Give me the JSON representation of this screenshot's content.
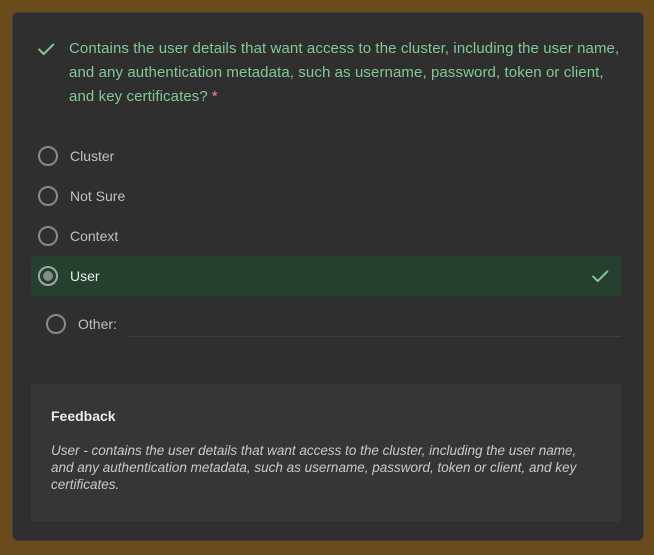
{
  "question": {
    "text": "Contains the user details that want access to the cluster, including the user name, and any authentication metadata, such as username, password, token or client, and key certificates?",
    "required_marker": "*",
    "status_icon": "check-icon"
  },
  "options": [
    {
      "label": "Cluster",
      "selected": false
    },
    {
      "label": "Not Sure",
      "selected": false
    },
    {
      "label": "Context",
      "selected": false
    },
    {
      "label": "User",
      "selected": true,
      "correct": true
    }
  ],
  "other": {
    "label": "Other:",
    "value": ""
  },
  "feedback": {
    "title": "Feedback",
    "body": "User - contains the user details that want access to the cluster, including the user name, and any authentication metadata, such as username, password, token or client, and key certificates."
  },
  "colors": {
    "correct_green": "#81c995",
    "selected_bg": "#25402f",
    "required_red": "#f28b82",
    "card_bg": "#2f2f30",
    "page_bg": "#6b4a1c"
  }
}
